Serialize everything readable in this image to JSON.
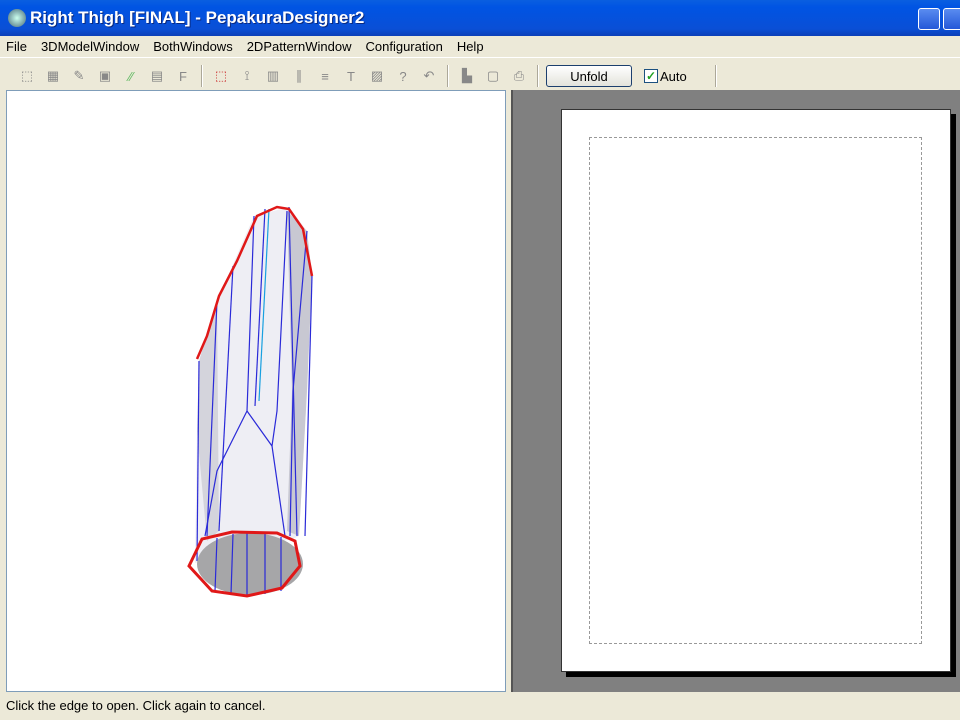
{
  "window": {
    "title": "Right Thigh [FINAL] - PepakuraDesigner2"
  },
  "menu": [
    "File",
    "3DModelWindow",
    "BothWindows",
    "2DPatternWindow",
    "Configuration",
    "Help"
  ],
  "toolbar": {
    "unfold_label": "Unfold",
    "auto_label": "Auto",
    "auto_checked": true
  },
  "status": {
    "text": "Click the edge to open. Click again to cancel."
  },
  "colors": {
    "cut_edge": "#e02020",
    "fold_edge": "#2020d0",
    "title_bar": "#0054e3",
    "pattern_bg": "#808080"
  }
}
